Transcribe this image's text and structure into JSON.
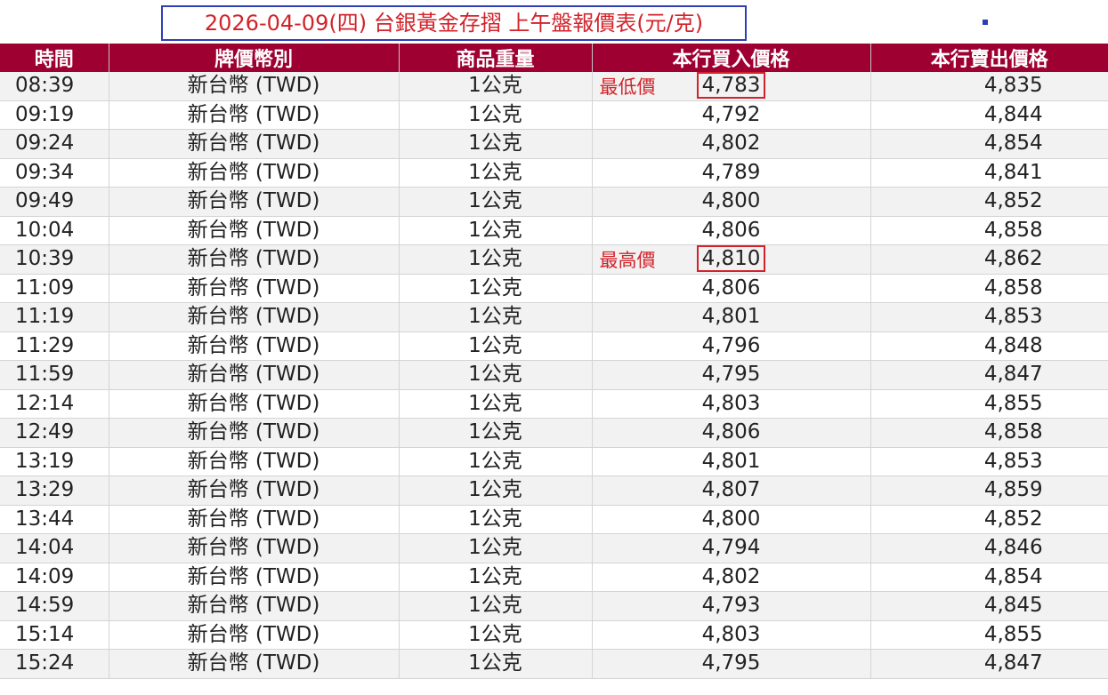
{
  "title": "2026-04-09(四) 台銀黃金存摺  上午盤報價表(元/克)",
  "columns": [
    "時間",
    "牌價幣別",
    "商品重量",
    "本行買入價格",
    "本行賣出價格"
  ],
  "rows": [
    {
      "time": "08:39",
      "currency": "新台幣 (TWD)",
      "weight": "1公克",
      "buy": "4,783",
      "sell": "4,835",
      "note": "最低價"
    },
    {
      "time": "09:19",
      "currency": "新台幣 (TWD)",
      "weight": "1公克",
      "buy": "4,792",
      "sell": "4,844"
    },
    {
      "time": "09:24",
      "currency": "新台幣 (TWD)",
      "weight": "1公克",
      "buy": "4,802",
      "sell": "4,854"
    },
    {
      "time": "09:34",
      "currency": "新台幣 (TWD)",
      "weight": "1公克",
      "buy": "4,789",
      "sell": "4,841"
    },
    {
      "time": "09:49",
      "currency": "新台幣 (TWD)",
      "weight": "1公克",
      "buy": "4,800",
      "sell": "4,852"
    },
    {
      "time": "10:04",
      "currency": "新台幣 (TWD)",
      "weight": "1公克",
      "buy": "4,806",
      "sell": "4,858"
    },
    {
      "time": "10:39",
      "currency": "新台幣 (TWD)",
      "weight": "1公克",
      "buy": "4,810",
      "sell": "4,862",
      "note": "最高價"
    },
    {
      "time": "11:09",
      "currency": "新台幣 (TWD)",
      "weight": "1公克",
      "buy": "4,806",
      "sell": "4,858"
    },
    {
      "time": "11:19",
      "currency": "新台幣 (TWD)",
      "weight": "1公克",
      "buy": "4,801",
      "sell": "4,853"
    },
    {
      "time": "11:29",
      "currency": "新台幣 (TWD)",
      "weight": "1公克",
      "buy": "4,796",
      "sell": "4,848"
    },
    {
      "time": "11:59",
      "currency": "新台幣 (TWD)",
      "weight": "1公克",
      "buy": "4,795",
      "sell": "4,847"
    },
    {
      "time": "12:14",
      "currency": "新台幣 (TWD)",
      "weight": "1公克",
      "buy": "4,803",
      "sell": "4,855"
    },
    {
      "time": "12:49",
      "currency": "新台幣 (TWD)",
      "weight": "1公克",
      "buy": "4,806",
      "sell": "4,858"
    },
    {
      "time": "13:19",
      "currency": "新台幣 (TWD)",
      "weight": "1公克",
      "buy": "4,801",
      "sell": "4,853"
    },
    {
      "time": "13:29",
      "currency": "新台幣 (TWD)",
      "weight": "1公克",
      "buy": "4,807",
      "sell": "4,859"
    },
    {
      "time": "13:44",
      "currency": "新台幣 (TWD)",
      "weight": "1公克",
      "buy": "4,800",
      "sell": "4,852"
    },
    {
      "time": "14:04",
      "currency": "新台幣 (TWD)",
      "weight": "1公克",
      "buy": "4,794",
      "sell": "4,846"
    },
    {
      "time": "14:09",
      "currency": "新台幣 (TWD)",
      "weight": "1公克",
      "buy": "4,802",
      "sell": "4,854"
    },
    {
      "time": "14:59",
      "currency": "新台幣 (TWD)",
      "weight": "1公克",
      "buy": "4,793",
      "sell": "4,845"
    },
    {
      "time": "15:14",
      "currency": "新台幣 (TWD)",
      "weight": "1公克",
      "buy": "4,803",
      "sell": "4,855"
    },
    {
      "time": "15:24",
      "currency": "新台幣 (TWD)",
      "weight": "1公克",
      "buy": "4,795",
      "sell": "4,847"
    }
  ],
  "colors": {
    "header_bg": "#9e0032",
    "title_text": "#d2232a",
    "title_border": "#2e3fb5",
    "highlight": "#d2232a"
  }
}
